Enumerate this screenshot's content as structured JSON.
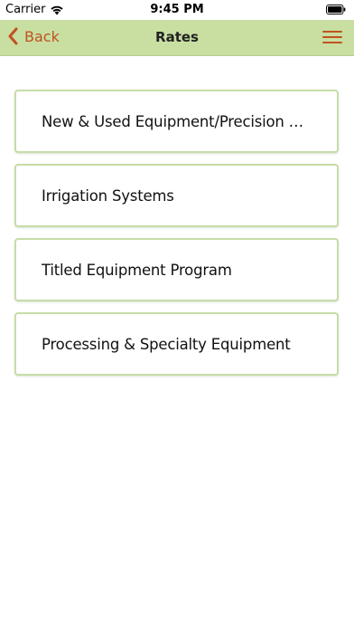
{
  "status_bar": {
    "carrier": "Carrier",
    "time": "9:45 PM"
  },
  "nav": {
    "back_label": "Back",
    "title": "Rates",
    "accent_color": "#c0531f",
    "bar_color": "#c9dfa2"
  },
  "rates": {
    "items": [
      {
        "label": "New & Used Equipment/Precision …"
      },
      {
        "label": "Irrigation Systems"
      },
      {
        "label": "Titled Equipment Program"
      },
      {
        "label": "Processing & Specialty Equipment"
      }
    ]
  }
}
